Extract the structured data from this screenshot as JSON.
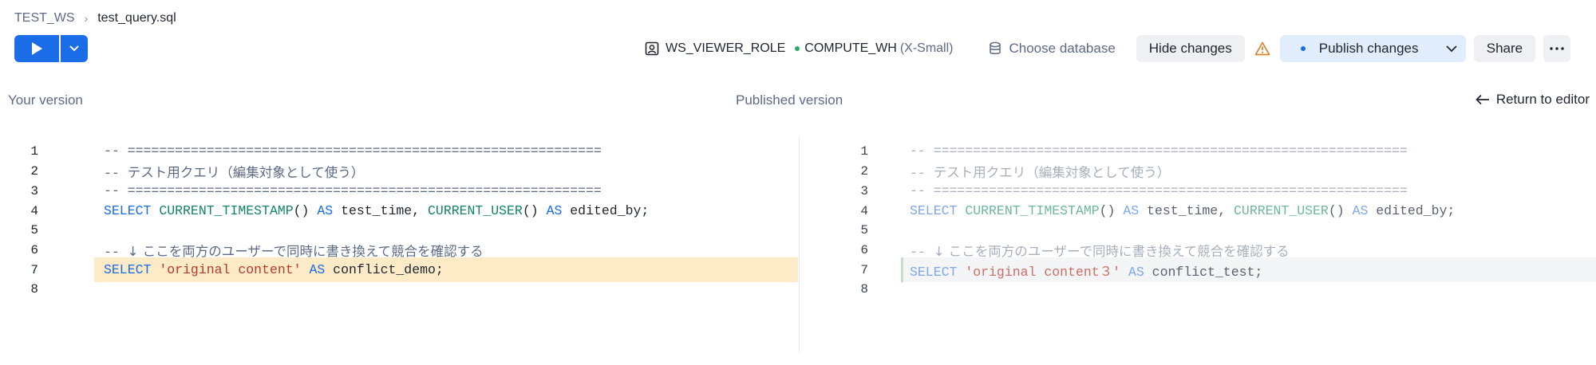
{
  "breadcrumb": {
    "workspace": "TEST_WS",
    "file": "test_query.sql"
  },
  "toolbar": {
    "role": "WS_VIEWER_ROLE",
    "warehouse": "COMPUTE_WH",
    "warehouse_size": "(X-Small)",
    "choose_database": "Choose database",
    "hide_changes": "Hide changes",
    "publish_changes": "Publish changes",
    "share": "Share"
  },
  "headers": {
    "left": "Your version",
    "center": "Published version",
    "return_link": "Return to editor"
  },
  "colors": {
    "accent": "#1a6ce7",
    "warehouse_dot": "#2aa86a",
    "changed_line_bg": "#fdebc8",
    "warning": "#d9822b"
  },
  "left": {
    "lines": [
      {
        "n": "1",
        "tokens": [
          {
            "t": "-- ",
            "c": "cm"
          },
          {
            "t": "============================================================",
            "c": "cm"
          }
        ]
      },
      {
        "n": "2",
        "tokens": [
          {
            "t": "-- ",
            "c": "cm"
          },
          {
            "t": "テスト用クエリ（編集対象として使う）",
            "c": "cm jp"
          }
        ]
      },
      {
        "n": "3",
        "tokens": [
          {
            "t": "-- ",
            "c": "cm"
          },
          {
            "t": "============================================================",
            "c": "cm"
          }
        ]
      },
      {
        "n": "4",
        "tokens": [
          {
            "t": "SELECT",
            "c": "kw"
          },
          {
            "t": " ",
            "c": "id"
          },
          {
            "t": "CURRENT_TIMESTAMP",
            "c": "fn"
          },
          {
            "t": "() ",
            "c": "id"
          },
          {
            "t": "AS",
            "c": "kw"
          },
          {
            "t": " test_time, ",
            "c": "id"
          },
          {
            "t": "CURRENT_USER",
            "c": "fn"
          },
          {
            "t": "() ",
            "c": "id"
          },
          {
            "t": "AS",
            "c": "kw"
          },
          {
            "t": " edited_by;",
            "c": "id"
          }
        ]
      },
      {
        "n": "5",
        "tokens": []
      },
      {
        "n": "6",
        "tokens": [
          {
            "t": "-- ",
            "c": "cm"
          },
          {
            "t": "↓ ここを両方のユーザーで同時に書き換えて競合を確認する",
            "c": "cm jp"
          }
        ]
      },
      {
        "n": "7",
        "tokens": [
          {
            "t": "SELECT",
            "c": "kw"
          },
          {
            "t": " ",
            "c": "id"
          },
          {
            "t": "'original content'",
            "c": "str"
          },
          {
            "t": " ",
            "c": "id"
          },
          {
            "t": "AS",
            "c": "kw"
          },
          {
            "t": " conflict_demo;",
            "c": "id"
          }
        ]
      },
      {
        "n": "8",
        "tokens": []
      }
    ]
  },
  "right": {
    "lines": [
      {
        "n": "1",
        "tokens": [
          {
            "t": "-- ",
            "c": "cm"
          },
          {
            "t": "============================================================",
            "c": "cm"
          }
        ]
      },
      {
        "n": "2",
        "tokens": [
          {
            "t": "-- ",
            "c": "cm"
          },
          {
            "t": "テスト用クエリ（編集対象として使う）",
            "c": "cm jp"
          }
        ]
      },
      {
        "n": "3",
        "tokens": [
          {
            "t": "-- ",
            "c": "cm"
          },
          {
            "t": "============================================================",
            "c": "cm"
          }
        ]
      },
      {
        "n": "4",
        "tokens": [
          {
            "t": "SELECT",
            "c": "kw"
          },
          {
            "t": " ",
            "c": "id"
          },
          {
            "t": "CURRENT_TIMESTAMP",
            "c": "fn"
          },
          {
            "t": "() ",
            "c": "id"
          },
          {
            "t": "AS",
            "c": "kw"
          },
          {
            "t": " test_time, ",
            "c": "id"
          },
          {
            "t": "CURRENT_USER",
            "c": "fn"
          },
          {
            "t": "() ",
            "c": "id"
          },
          {
            "t": "AS",
            "c": "kw"
          },
          {
            "t": " edited_by;",
            "c": "id"
          }
        ]
      },
      {
        "n": "5",
        "tokens": []
      },
      {
        "n": "6",
        "tokens": [
          {
            "t": "-- ",
            "c": "cm"
          },
          {
            "t": "↓ ここを両方のユーザーで同時に書き換えて競合を確認する",
            "c": "cm jp"
          }
        ]
      },
      {
        "n": "7",
        "tokens": [
          {
            "t": "SELECT",
            "c": "kw"
          },
          {
            "t": " ",
            "c": "id"
          },
          {
            "t": "'original content３'",
            "c": "str"
          },
          {
            "t": " ",
            "c": "id"
          },
          {
            "t": "AS",
            "c": "kw"
          },
          {
            "t": " conflict_test;",
            "c": "id"
          }
        ]
      },
      {
        "n": "8",
        "tokens": []
      }
    ]
  }
}
